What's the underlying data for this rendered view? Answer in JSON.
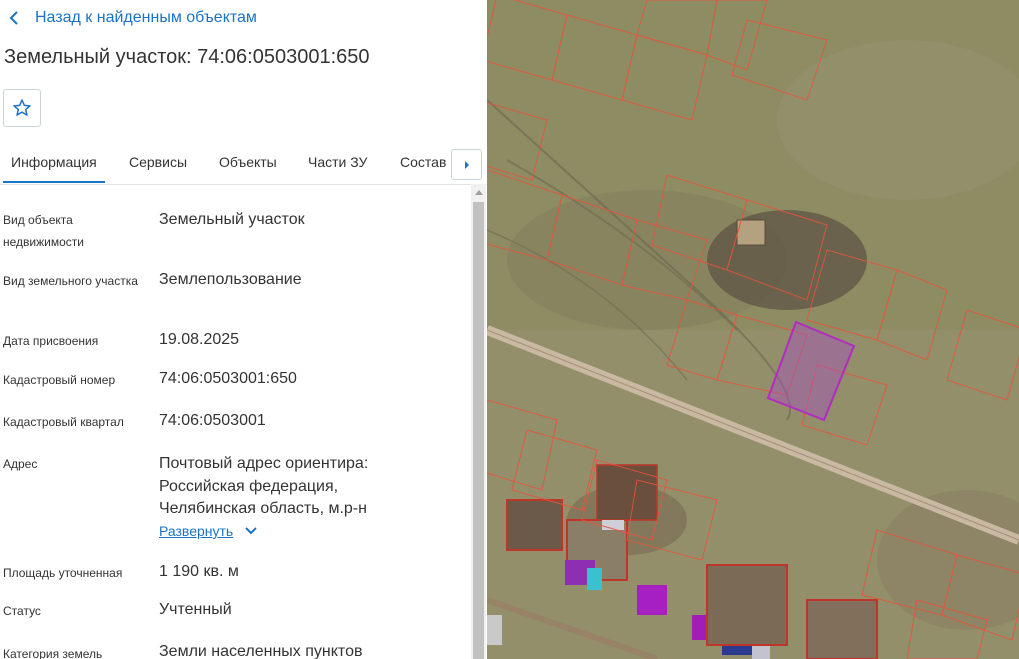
{
  "back_link": {
    "label": "Назад к найденным объектам"
  },
  "page_title": "Земельный участок: 74:06:0503001:650",
  "tabs": [
    {
      "label": "Информация",
      "active": true
    },
    {
      "label": "Сервисы"
    },
    {
      "label": "Объекты"
    },
    {
      "label": "Части ЗУ"
    },
    {
      "label": "Состав"
    }
  ],
  "fields": {
    "object_type": {
      "label": "Вид объекта недвижимости",
      "value": "Земельный участок"
    },
    "plot_type": {
      "label": "Вид земельного участка",
      "value": "Землепользование"
    },
    "assign_date": {
      "label": "Дата присвоения",
      "value": "19.08.2025"
    },
    "cadastral_number": {
      "label": "Кадастровый номер",
      "value": "74:06:0503001:650"
    },
    "cadastral_block": {
      "label": "Кадастровый квартал",
      "value": "74:06:0503001"
    },
    "address": {
      "label": "Адрес",
      "lines": [
        "Почтовый адрес ориентира:",
        "Российская федерация,",
        "Челябинская область, м.р-н"
      ],
      "expand_label": "Развернуть"
    },
    "area": {
      "label": "Площадь уточненная",
      "value": "1 190 кв. м"
    },
    "status": {
      "label": "Статус",
      "value": "Учтенный"
    },
    "land_category": {
      "label": "Категория земель",
      "value": "Земли населенных пунктов"
    }
  },
  "colors": {
    "accent": "#1a73c7",
    "parcel_border": "#e8543a",
    "selected_parcel": "#b32bc0"
  },
  "icons": {
    "back": "chevron-left-icon",
    "favorite": "star-icon",
    "tabs_next": "caret-right-icon",
    "expand": "chevron-down-icon"
  }
}
